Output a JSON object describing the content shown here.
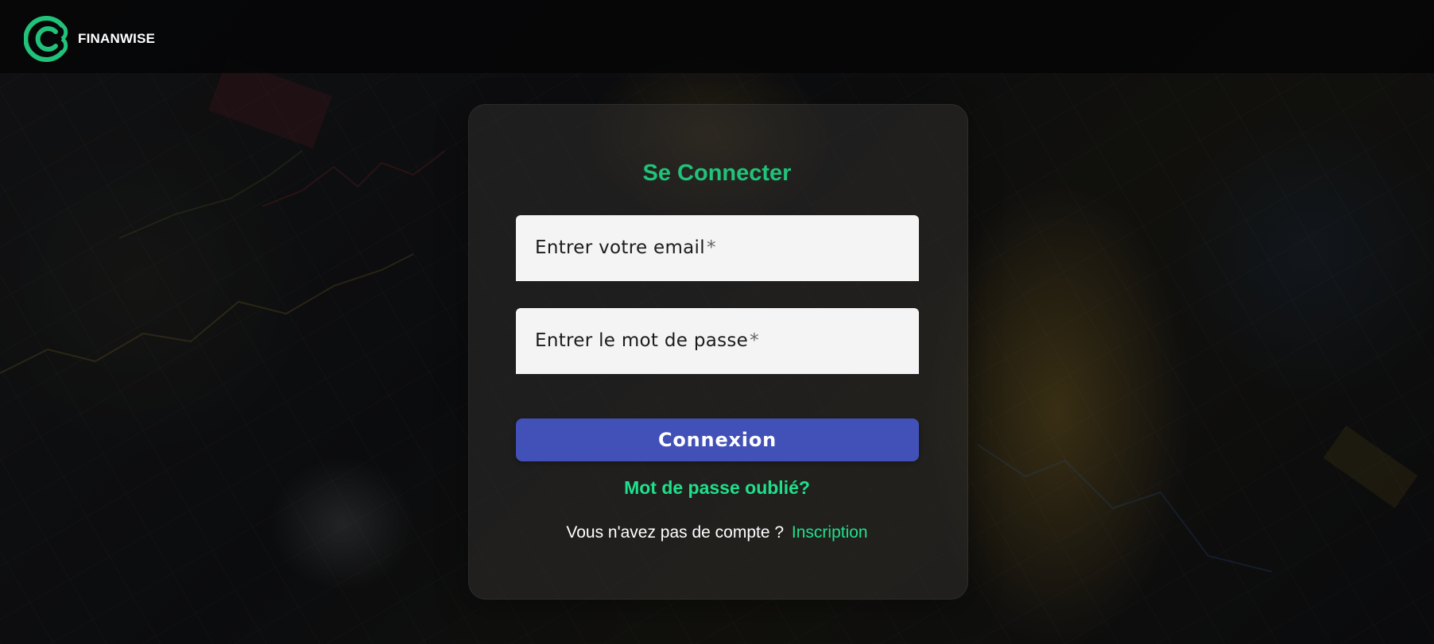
{
  "brand": {
    "name": "FINANWISE",
    "logo_icon": "finanwise-logo-icon",
    "accent_color": "#21c27a"
  },
  "login": {
    "title": "Se Connecter",
    "email": {
      "label": "Entrer votre email",
      "required_mark": "*",
      "value": ""
    },
    "password": {
      "label": "Entrer le mot de passe",
      "required_mark": "*",
      "value": ""
    },
    "submit_label": "Connexion",
    "submit_color": "#4151b8",
    "forgot_password_label": "Mot de passe oublié?",
    "signup_prompt": "Vous n'avez pas de compte ?",
    "signup_link_label": "Inscription",
    "link_color": "#1fe08a"
  }
}
